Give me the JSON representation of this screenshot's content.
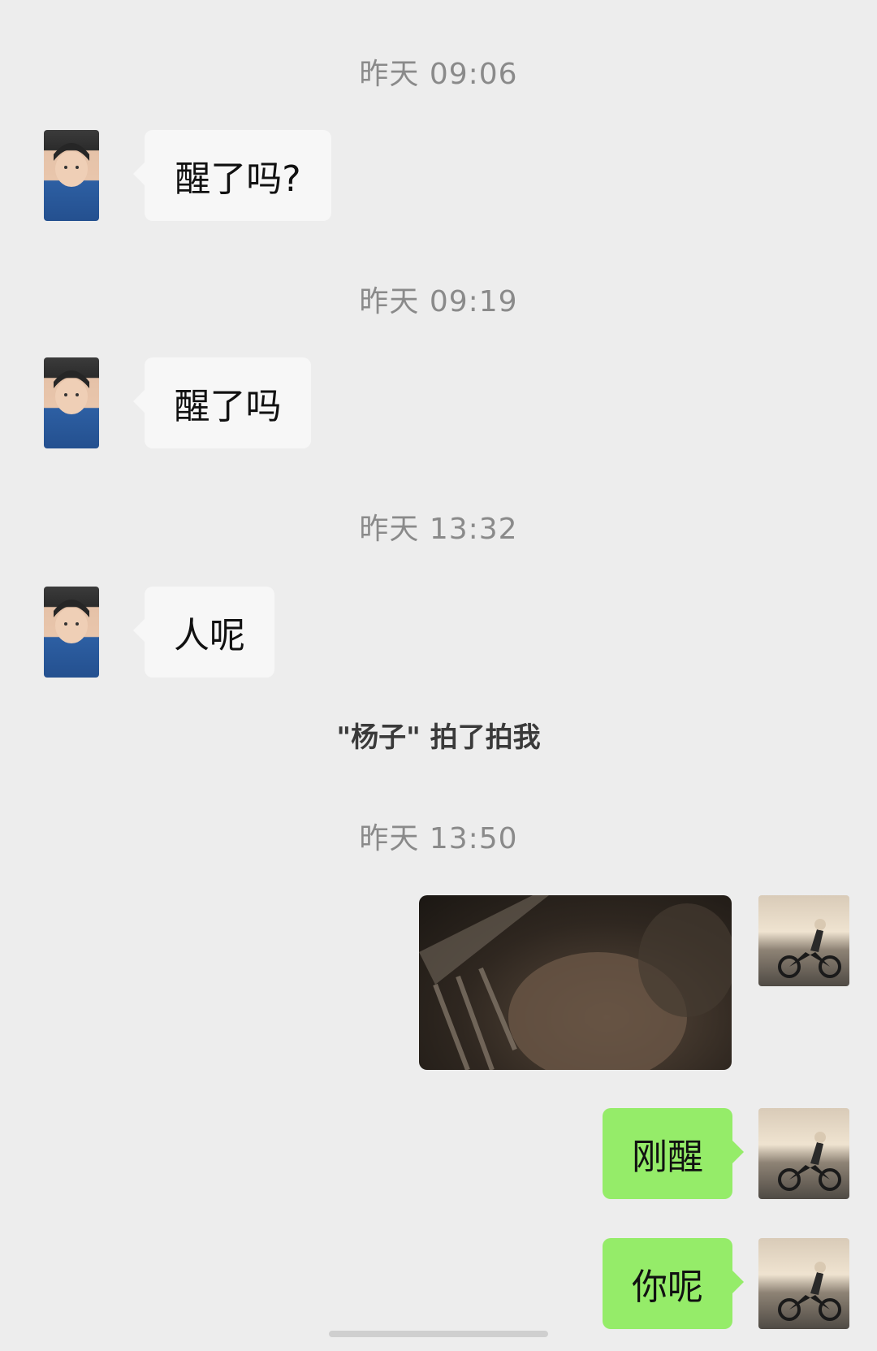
{
  "messages": [
    {
      "type": "timestamp",
      "text": "昨天 09:06"
    },
    {
      "type": "incoming",
      "sender": "杨子",
      "text": "醒了吗?"
    },
    {
      "type": "timestamp",
      "text": "昨天 09:19"
    },
    {
      "type": "incoming",
      "sender": "杨子",
      "text": "醒了吗"
    },
    {
      "type": "timestamp",
      "text": "昨天 13:32"
    },
    {
      "type": "incoming",
      "sender": "杨子",
      "text": "人呢"
    },
    {
      "type": "system",
      "text": "\"杨子\" 拍了拍我"
    },
    {
      "type": "timestamp",
      "text": "昨天 13:50"
    },
    {
      "type": "outgoing_image",
      "image": "dim-selfie-photo"
    },
    {
      "type": "outgoing",
      "text": "刚醒"
    },
    {
      "type": "outgoing",
      "text": "你呢"
    }
  ],
  "colors": {
    "background": "#ededed",
    "incoming_bubble": "#f7f7f7",
    "outgoing_bubble": "#95ec69",
    "timestamp": "#8a8a8a"
  }
}
